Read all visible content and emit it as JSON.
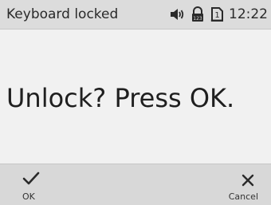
{
  "status_bar": {
    "title": "Keyboard locked",
    "time": "12:22",
    "icons": [
      "volume-icon",
      "keypad-lock-icon",
      "sim-1-icon"
    ],
    "sim_number": "1",
    "lock_small_text": "123"
  },
  "main": {
    "message": "Unlock? Press OK."
  },
  "softkeys": {
    "left": {
      "label": "OK",
      "icon": "check-icon"
    },
    "right": {
      "label": "Cancel",
      "icon": "close-icon"
    }
  },
  "colors": {
    "background": "#f1f1f1",
    "status_bar_bg": "#dcdcdc",
    "softkey_bar_bg": "#d8d8d8",
    "text": "#222222"
  }
}
